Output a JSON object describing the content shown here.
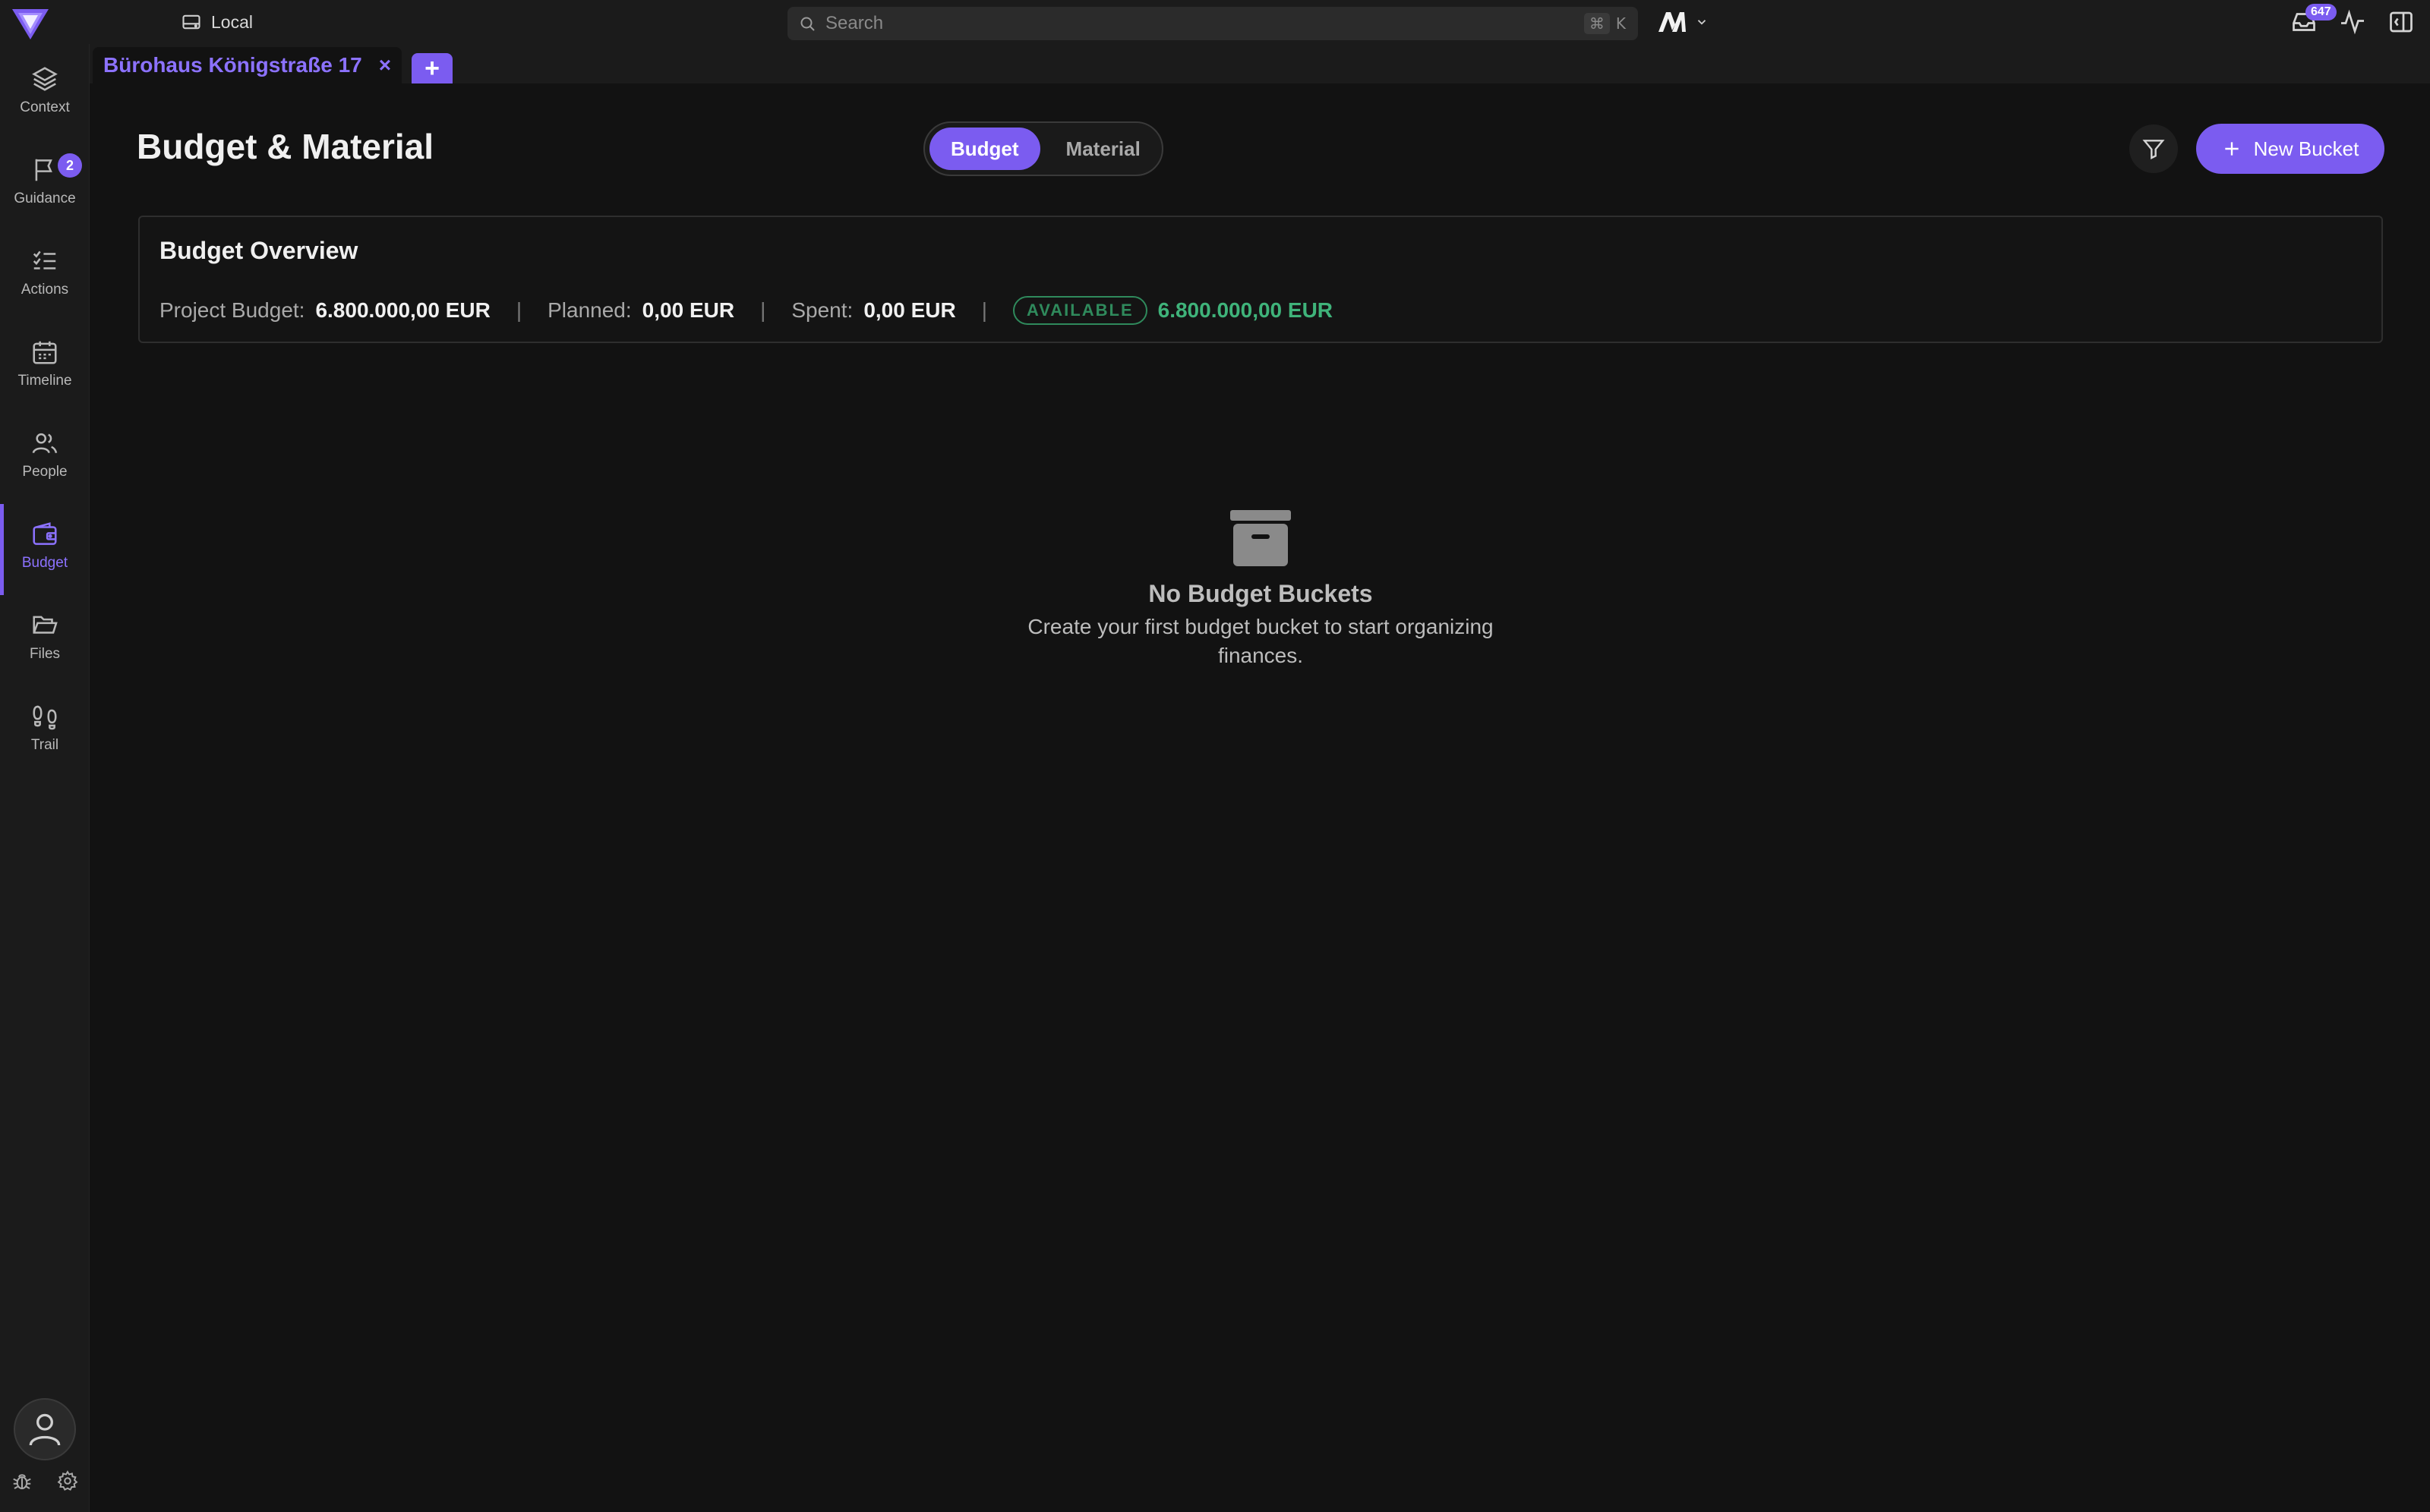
{
  "topbar": {
    "environment_label": "Local",
    "search_placeholder": "Search",
    "shortcut_key1": "⌘",
    "shortcut_key2": "K",
    "inbox_count": "647"
  },
  "sidebar": {
    "items": [
      {
        "label": "Context",
        "icon": "layers-icon"
      },
      {
        "label": "Guidance",
        "icon": "flag-icon",
        "badge": "2"
      },
      {
        "label": "Actions",
        "icon": "checklist-icon"
      },
      {
        "label": "Timeline",
        "icon": "calendar-icon"
      },
      {
        "label": "People",
        "icon": "people-icon"
      },
      {
        "label": "Budget",
        "icon": "wallet-icon",
        "active": true
      },
      {
        "label": "Files",
        "icon": "folder-icon"
      },
      {
        "label": "Trail",
        "icon": "footprints-icon"
      }
    ]
  },
  "tabs": {
    "active_title": "Bürohaus Königstraße 17",
    "close_glyph": "×",
    "add_glyph": "+"
  },
  "main": {
    "title": "Budget & Material",
    "segments": [
      "Budget",
      "Material"
    ],
    "new_bucket_label": "New Bucket"
  },
  "overview": {
    "title": "Budget Overview",
    "project_budget_label": "Project Budget:",
    "project_budget_value": "6.800.000,00 EUR",
    "planned_label": "Planned:",
    "planned_value": "0,00 EUR",
    "spent_label": "Spent:",
    "spent_value": "0,00 EUR",
    "available_badge": "AVAILABLE",
    "available_value": "6.800.000,00 EUR",
    "separator": "|"
  },
  "empty_state": {
    "title": "No Budget Buckets",
    "description": "Create your first budget bucket to start organizing finances."
  },
  "colors": {
    "accent": "#7b5cf0",
    "available_green": "#3fb37a"
  }
}
